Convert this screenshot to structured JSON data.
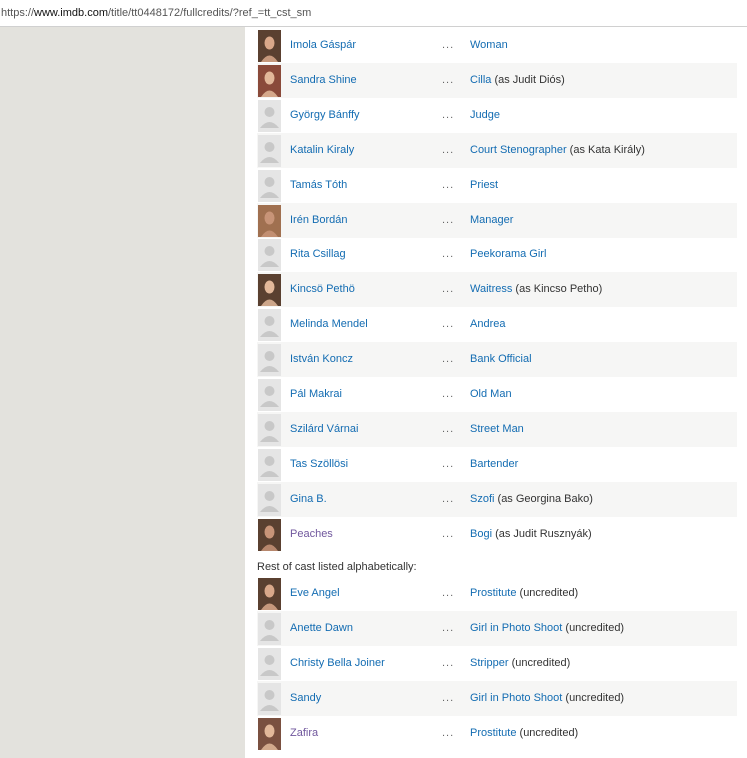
{
  "address_bar": {
    "prefix": "https://",
    "host": "www.imdb.com",
    "path": "/title/tt0448172/fullcredits/?ref_=tt_cst_sm"
  },
  "cast": [
    {
      "actor": "Imola Gáspár",
      "character": "Woman",
      "note": "",
      "photo": "photo"
    },
    {
      "actor": "Sandra Shine",
      "character": "Cilla",
      "note": " (as Judit Diós)",
      "photo": "photo"
    },
    {
      "actor": "György Bánffy",
      "character": "Judge",
      "note": "",
      "photo": "placeholder"
    },
    {
      "actor": "Katalin Kiraly",
      "character": "Court Stenographer",
      "note": " (as Kata Király)",
      "photo": "placeholder"
    },
    {
      "actor": "Tamás Tóth",
      "character": "Priest",
      "note": "",
      "photo": "placeholder"
    },
    {
      "actor": "Irén Bordán",
      "character": "Manager",
      "note": "",
      "photo": "photo"
    },
    {
      "actor": "Rita Csillag",
      "character": "Peekorama Girl",
      "note": "",
      "photo": "placeholder"
    },
    {
      "actor": "Kincsö Pethö",
      "character": "Waitress",
      "note": " (as Kincso Petho)",
      "photo": "photo"
    },
    {
      "actor": "Melinda Mendel",
      "character": "Andrea",
      "note": "",
      "photo": "placeholder"
    },
    {
      "actor": "István Koncz",
      "character": "Bank Official",
      "note": "",
      "photo": "placeholder"
    },
    {
      "actor": "Pál Makrai",
      "character": "Old Man",
      "note": "",
      "photo": "placeholder"
    },
    {
      "actor": "Szilárd Várnai",
      "character": "Street Man",
      "note": "",
      "photo": "placeholder"
    },
    {
      "actor": "Tas Szöllösi",
      "character": "Bartender",
      "note": "",
      "photo": "placeholder"
    },
    {
      "actor": "Gina B.",
      "character": "Szofi",
      "note": " (as Georgina Bako)",
      "photo": "placeholder"
    },
    {
      "actor": "Peaches",
      "character": "Bogi",
      "note": " (as Judit Rusznyák)",
      "photo": "photo"
    }
  ],
  "rest_label": "Rest of cast listed alphabetically:",
  "rest_cast": [
    {
      "actor": "Eve Angel",
      "character": "Prostitute",
      "note": " (uncredited)",
      "photo": "photo"
    },
    {
      "actor": "Anette Dawn",
      "character": "Girl in Photo Shoot",
      "note": " (uncredited)",
      "photo": "placeholder"
    },
    {
      "actor": "Christy Bella Joiner",
      "character": "Stripper",
      "note": " (uncredited)",
      "photo": "placeholder"
    },
    {
      "actor": "Sandy",
      "character": "Girl in Photo Shoot",
      "note": " (uncredited)",
      "photo": "placeholder"
    },
    {
      "actor": "Zafira",
      "character": "Prostitute",
      "note": " (uncredited)",
      "photo": "photo"
    }
  ],
  "ellipsis": "...",
  "colors": {
    "link": "#136cb2",
    "visited_link": "#70579d",
    "row_alt": "#f6f6f5",
    "sidebar": "#e3e2dd"
  }
}
